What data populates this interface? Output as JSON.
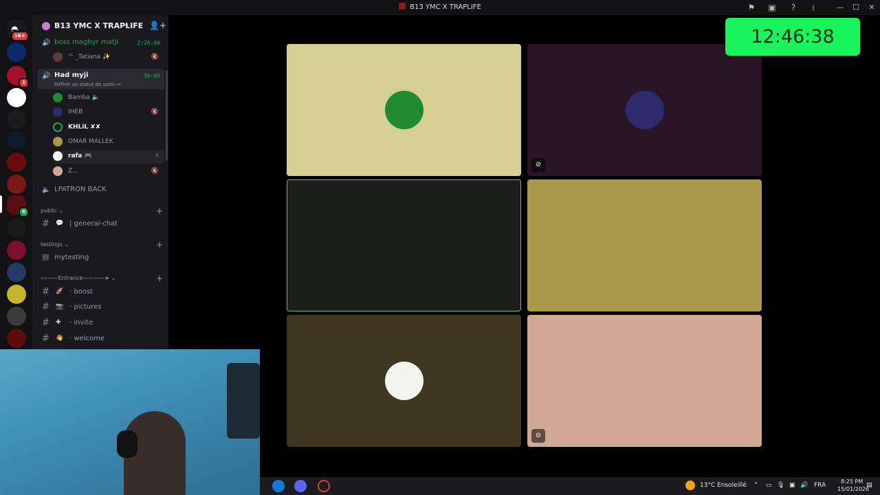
{
  "window": {
    "title": "B13 YMC X TRAPLIFE"
  },
  "titlebar_icons": [
    "flag-icon",
    "inbox-icon",
    "help-icon",
    "download-icon"
  ],
  "window_controls": {
    "minimize": "—",
    "maximize": "☐",
    "close": "✕"
  },
  "rail": {
    "badges": {
      "top": "1K+",
      "second": "1",
      "third": "6"
    },
    "colors": [
      "#e03a3e",
      "#0d2a6b",
      "#a3112a",
      "#ffffff",
      "#1c1c1c",
      "#0e1a2a",
      "#6b0d0d",
      "#7a1717",
      "#111111",
      "#1a1a1a",
      "#7c0f2b",
      "#233b64",
      "#c7b42c",
      "#3b3b3b",
      "#5b0d0d"
    ]
  },
  "server": {
    "name": "B13 YMC X TRAPLIFE"
  },
  "voice_channels": [
    {
      "name": "boss maghyr matji",
      "timer": "2:26:00",
      "users": [
        {
          "name": "^ _Tatiana ✨",
          "bold": false,
          "status": "🔇"
        }
      ]
    },
    {
      "name": "Had myji",
      "timer": "30:00",
      "status": "Définir un statut de salon ✏",
      "users": [
        {
          "name": "Bamba 🔈",
          "bold": false,
          "status": ""
        },
        {
          "name": "IHEB",
          "bold": false,
          "status": "🔇"
        },
        {
          "name": "KHLiL ✘✘",
          "bold": true,
          "status": ""
        },
        {
          "name": "OMAR MALLEK",
          "bold": false,
          "status": ""
        },
        {
          "name": "rafa 🎮",
          "bold": true,
          "status": ""
        },
        {
          "name": "Z...",
          "bold": false,
          "status": "🔇"
        }
      ]
    },
    {
      "name": "LPATRON BACK",
      "timer": ""
    }
  ],
  "categories": [
    {
      "label": "public ⌄",
      "plus": "+"
    },
    {
      "label": "testings ⌄",
      "plus": "+"
    },
    {
      "label": "›››——Entrance————➤ ⌄",
      "plus": "+"
    }
  ],
  "text_channels": {
    "general": {
      "emoji": "💬",
      "name": "| general-chat"
    },
    "mytesting": {
      "name": "mytesting"
    },
    "boost": {
      "emoji": "🚀",
      "name": "· boost"
    },
    "pictures": {
      "emoji": "📷",
      "name": "· pictures"
    },
    "invite": {
      "emoji": "✚",
      "name": "· invite"
    },
    "welcome": {
      "emoji": "👋",
      "name": "· welcome"
    }
  },
  "clock": {
    "time": "12:46:38"
  },
  "tiles": [
    {
      "bg": "#d5cf94",
      "avatar_color": "#1f8a2e",
      "muted": false,
      "speaking": false
    },
    {
      "bg": "#2a1428",
      "avatar_color": "#2b2b6e",
      "muted": true,
      "speaking": false
    },
    {
      "bg": "#1c1e1c",
      "avatar_color": "#1c1e1c",
      "muted": false,
      "speaking": true
    },
    {
      "bg": "#a99a4b",
      "avatar_color": "#a99a4b",
      "muted": false,
      "speaking": false
    },
    {
      "bg": "#3f3621",
      "avatar_color": "#f5f5f0",
      "muted": false,
      "speaking": false
    },
    {
      "bg": "#d1a893",
      "avatar_color": "#d1a893",
      "muted": true,
      "speaking": false
    }
  ],
  "taskbar": {
    "weather": "13°C  Ensoleillé",
    "lang": "FRA",
    "time": "8:25 PM",
    "date": "15/01/2026"
  }
}
